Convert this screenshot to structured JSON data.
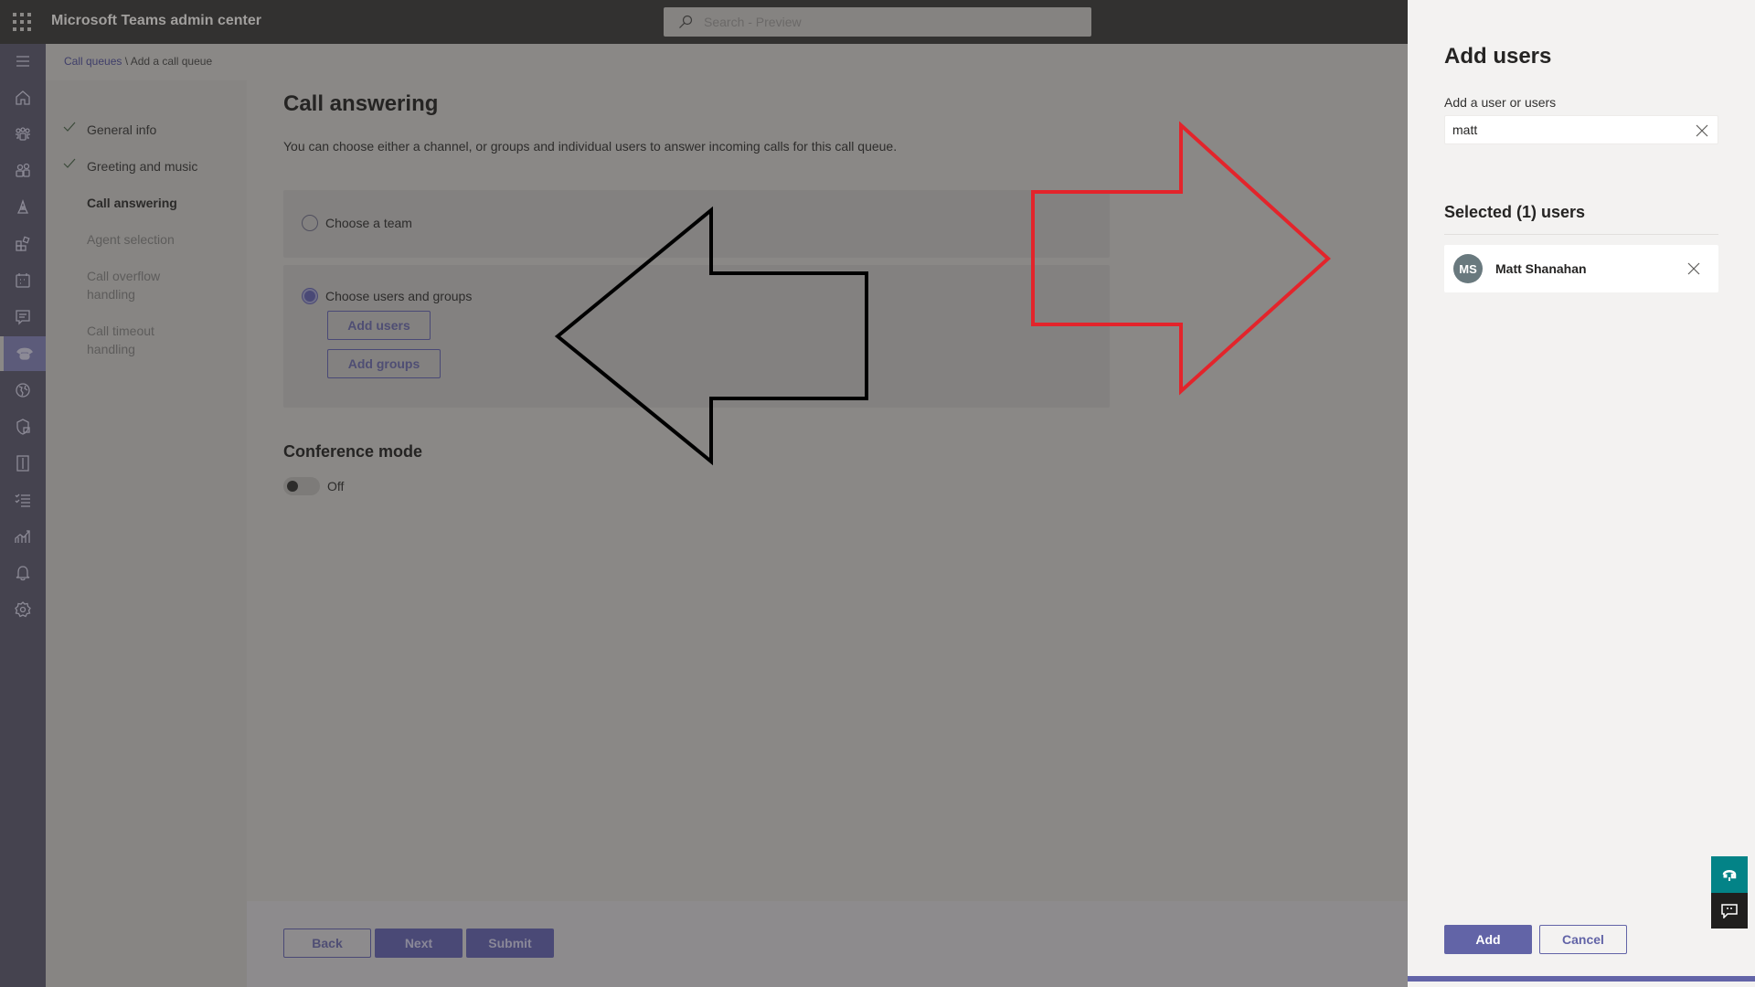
{
  "app": {
    "title": "Microsoft Teams admin center",
    "search_placeholder": "Search - Preview"
  },
  "rail": {
    "items": [
      {
        "icon": "menu-icon"
      },
      {
        "icon": "home-icon"
      },
      {
        "icon": "teams-icon"
      },
      {
        "icon": "users-icon"
      },
      {
        "icon": "devices-icon"
      },
      {
        "icon": "apps-icon"
      },
      {
        "icon": "meetings-icon"
      },
      {
        "icon": "messaging-icon"
      },
      {
        "icon": "voice-icon",
        "active": true
      },
      {
        "icon": "locations-icon"
      },
      {
        "icon": "policy-packages-icon"
      },
      {
        "icon": "planning-icon"
      },
      {
        "icon": "tasks-icon"
      },
      {
        "icon": "analytics-icon"
      },
      {
        "icon": "notifications-icon"
      },
      {
        "icon": "settings-icon"
      }
    ]
  },
  "breadcrumb": {
    "parent": "Call queues",
    "separator": " \\ ",
    "current": "Add a call queue"
  },
  "steps": [
    {
      "label": "General info",
      "state": "done"
    },
    {
      "label": "Greeting and music",
      "state": "done"
    },
    {
      "label": "Call answering",
      "state": "current"
    },
    {
      "label": "Agent selection",
      "state": "todo"
    },
    {
      "label": "Call overflow handling",
      "state": "todo"
    },
    {
      "label": "Call timeout handling",
      "state": "todo"
    }
  ],
  "content": {
    "title": "Call answering",
    "description": "You can choose either a channel, or groups and individual users to answer incoming calls for this call queue.",
    "option_team": "Choose a team",
    "option_users": "Choose users and groups",
    "selected_option": "Choose users and groups",
    "add_users": "Add users",
    "add_groups": "Add groups",
    "conference_title": "Conference mode",
    "conference_state": "Off"
  },
  "footer": {
    "back": "Back",
    "next": "Next",
    "submit": "Submit"
  },
  "panel": {
    "title": "Add users",
    "field_label": "Add a user or users",
    "field_value": "matt",
    "selected_title": "Selected (1) users",
    "selected_users": [
      {
        "initials": "MS",
        "name": "Matt Shanahan"
      }
    ],
    "add": "Add",
    "cancel": "Cancel"
  },
  "annotations": {
    "left_arrow_color": "#000000",
    "right_arrow_color": "#e3242b"
  },
  "colors": {
    "brand": "#6264a7",
    "help": "#038387"
  }
}
